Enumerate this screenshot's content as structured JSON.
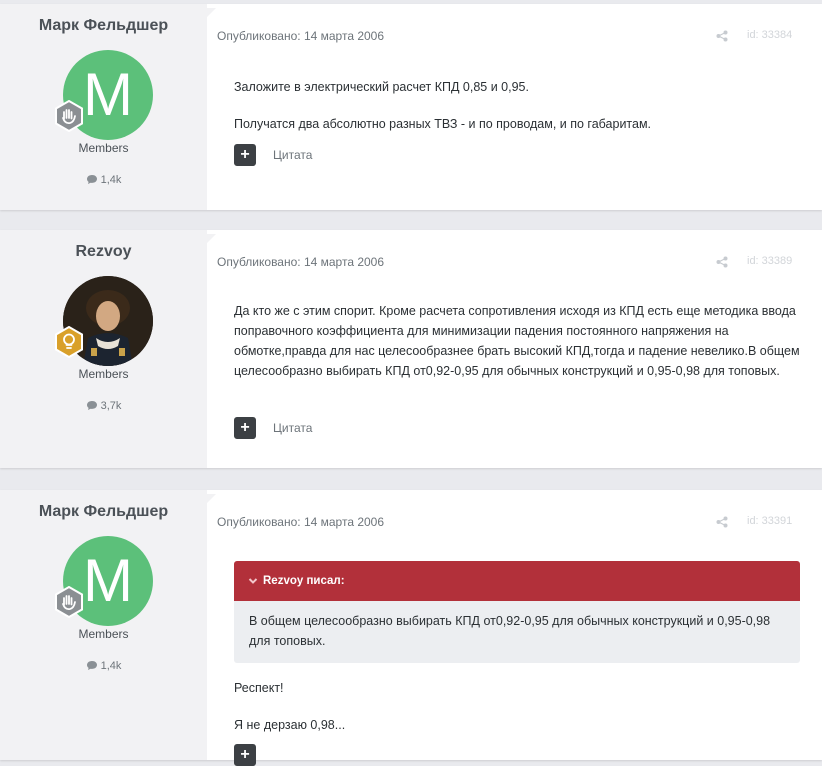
{
  "posts": [
    {
      "author": "Марк Фельдшер",
      "avatar_letter": "M",
      "avatar_color": "#5cc07a",
      "rank_icon": "hand-icon",
      "group": "Members",
      "post_count": "1,4k",
      "meta": "Опубликовано: 14 марта 2006",
      "post_id": "id: 33384",
      "paragraphs": [
        "Заложите в электрический расчет КПД 0,85 и 0,95.",
        "Получатся два абсолютно разных ТВЗ - и по проводам, и по габаритам."
      ],
      "quote_label": "Цитата"
    },
    {
      "author": "Rezvoy",
      "avatar_color": "#3a2e24",
      "rank_icon": "lightbulb-icon",
      "group": "Members",
      "post_count": "3,7k",
      "meta": "Опубликовано: 14 марта 2006",
      "post_id": "id: 33389",
      "paragraphs": [
        "Да кто же с этим спорит. Кроме расчета сопротивления исходя из КПД есть еще методика ввода поправочного коэффициента для минимизации падения постоянного напряжения на обмотке,правда для нас целесообразнее брать высокий КПД,тогда и падение невелико.В общем целесообразно выбирать КПД от0,92-0,95 для обычных конструкций и 0,95-0,98 для топовых."
      ],
      "quote_label": "Цитата"
    },
    {
      "author": "Марк Фельдшер",
      "avatar_letter": "M",
      "avatar_color": "#5cc07a",
      "rank_icon": "hand-icon",
      "group": "Members",
      "post_count": "1,4k",
      "meta": "Опубликовано: 14 марта 2006",
      "post_id": "id: 33391",
      "quote_header": "Rezvoy писал:",
      "quote_text": "В общем целесообразно выбирать КПД от0,92-0,95 для обычных конструкций и 0,95-0,98 для топовых.",
      "paragraphs": [
        "Респект!",
        "Я не дерзаю 0,98..."
      ]
    }
  ],
  "colors": {
    "accent_red": "#b2303a",
    "button_dark": "#3c4044",
    "rank_gold": "#d9a02a",
    "rank_gray": "#8b8f93"
  }
}
